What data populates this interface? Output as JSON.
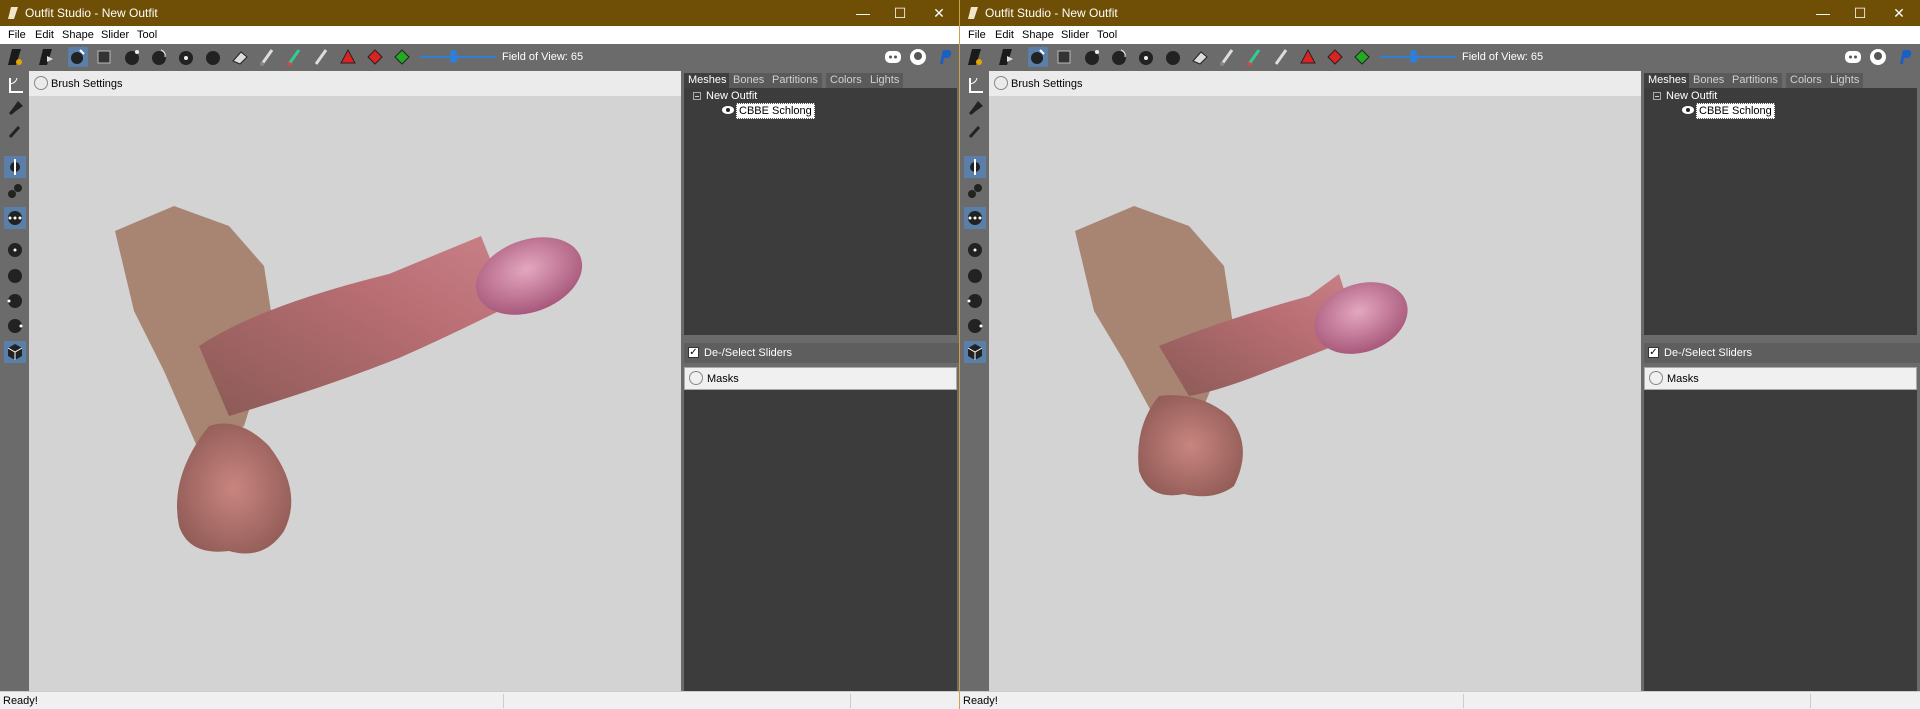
{
  "windows": [
    {
      "title": "Outfit Studio - New Outfit",
      "menu": [
        "File",
        "Edit",
        "Shape",
        "Slider",
        "Tool"
      ],
      "fov_label": "Field of View: 65",
      "brush_settings": "Brush Settings",
      "tabs": [
        "Meshes",
        "Bones",
        "Partitions",
        "Colors",
        "Lights"
      ],
      "tree_root": "New Outfit",
      "tree_child": "CBBE Schlong",
      "sliders_toggle": "De-/Select Sliders",
      "masks": "Masks",
      "status": "Ready!"
    },
    {
      "title": "Outfit Studio - New Outfit",
      "menu": [
        "File",
        "Edit",
        "Shape",
        "Slider",
        "Tool"
      ],
      "fov_label": "Field of View: 65",
      "brush_settings": "Brush Settings",
      "tabs": [
        "Meshes",
        "Bones",
        "Partitions",
        "Colors",
        "Lights"
      ],
      "tree_root": "New Outfit",
      "tree_child": "CBBE Schlong",
      "sliders_toggle": "De-/Select Sliders",
      "masks": "Masks",
      "status": "Ready!"
    }
  ],
  "colors": {
    "titlebar": "#6f4e05",
    "toolbar": "#6b6b6b",
    "viewport": "#d3d3d3",
    "panel": "#3c3c3c",
    "accent": "#2f7fd8"
  }
}
